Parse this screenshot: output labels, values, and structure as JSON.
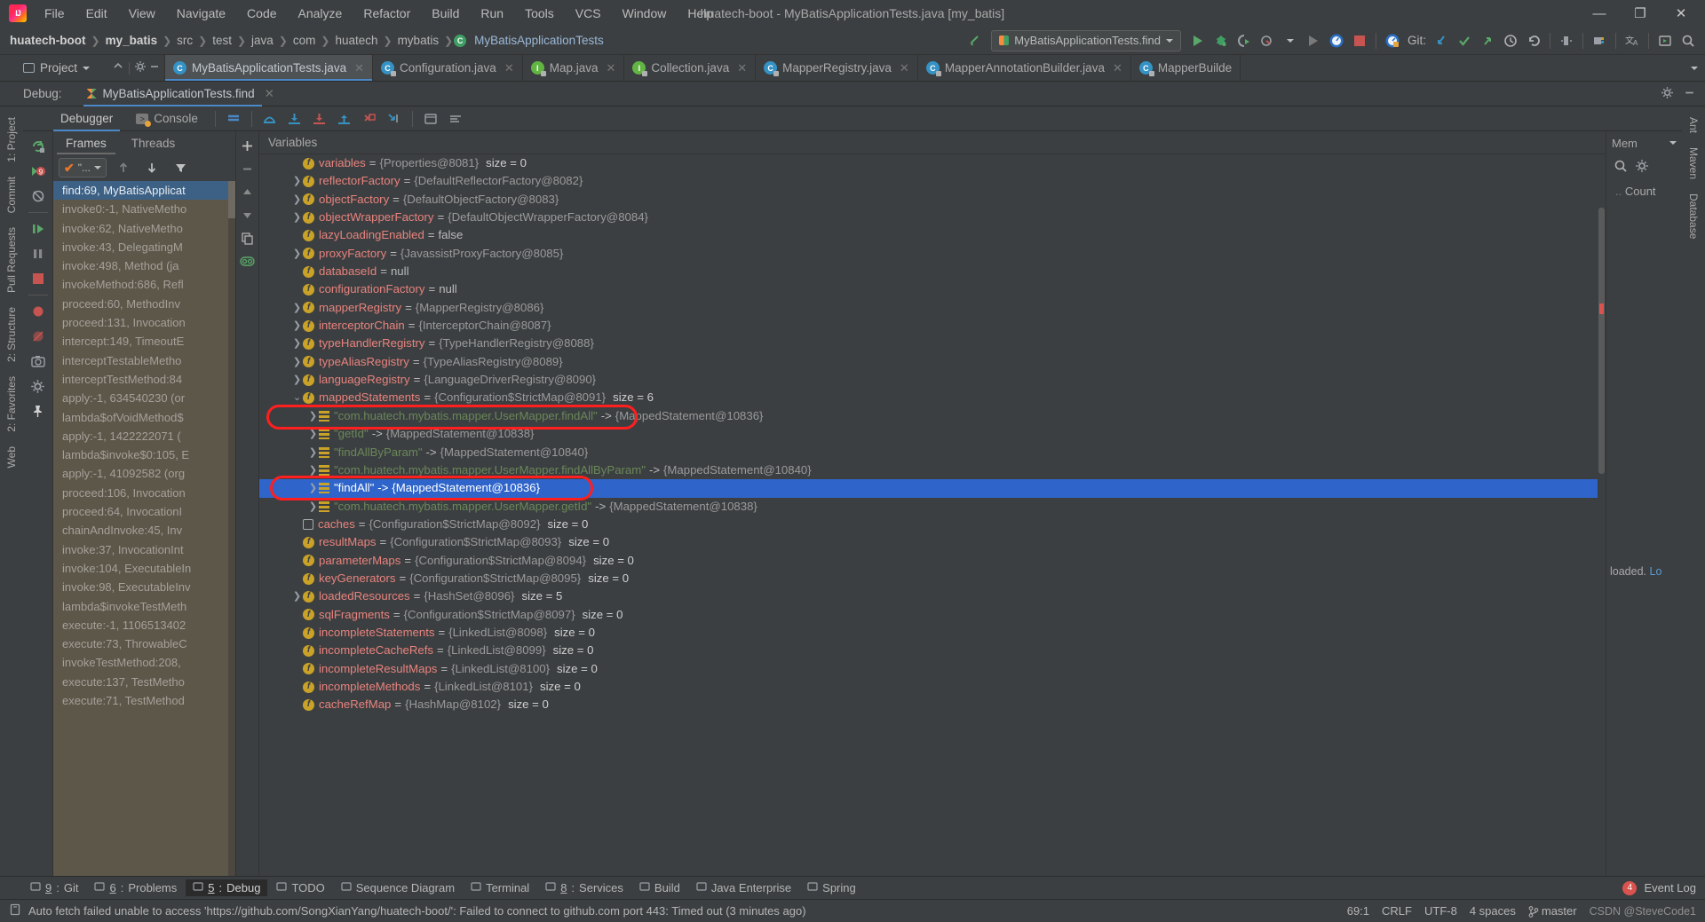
{
  "window": {
    "title": "huatech-boot - MyBatisApplicationTests.java [my_batis]",
    "minimize": "—",
    "maximize": "❐",
    "close": "✕"
  },
  "menu": [
    "File",
    "Edit",
    "View",
    "Navigate",
    "Code",
    "Analyze",
    "Refactor",
    "Build",
    "Run",
    "Tools",
    "VCS",
    "Window",
    "Help"
  ],
  "breadcrumb": [
    {
      "label": "huatech-boot",
      "bold": true
    },
    {
      "label": "my_batis",
      "bold": true
    },
    {
      "label": "src",
      "bold": false
    },
    {
      "label": "test",
      "bold": false
    },
    {
      "label": "java",
      "bold": false
    },
    {
      "label": "com",
      "bold": false
    },
    {
      "label": "huatech",
      "bold": false
    },
    {
      "label": "mybatis",
      "bold": false
    },
    {
      "label": "MyBatisApplicationTests",
      "bold": false,
      "cls": true
    }
  ],
  "run_toolbar": {
    "config_name": "MyBatisApplicationTests.find",
    "git_label": "Git:"
  },
  "editor_tabs": [
    {
      "label": "MyBatisApplicationTests.java",
      "kind": "c",
      "active": true
    },
    {
      "label": "Configuration.java",
      "kind": "c",
      "active": false
    },
    {
      "label": "Map.java",
      "kind": "i",
      "active": false
    },
    {
      "label": "Collection.java",
      "kind": "i",
      "active": false
    },
    {
      "label": "MapperRegistry.java",
      "kind": "c",
      "active": false
    },
    {
      "label": "MapperAnnotationBuilder.java",
      "kind": "c",
      "active": false
    },
    {
      "label": "MapperBuilde",
      "kind": "c",
      "active": false
    }
  ],
  "project_panel": {
    "title": "Project"
  },
  "debug_window": {
    "label": "Debug:",
    "session_tab": "MyBatisApplicationTests.find",
    "subtabs": [
      {
        "label": "Debugger",
        "active": true
      },
      {
        "label": "Console",
        "active": false
      }
    ],
    "frames_tabs": [
      {
        "label": "Frames",
        "active": true
      },
      {
        "label": "Threads",
        "active": false
      }
    ],
    "thread_selector": "\"...",
    "variables_title": "Variables"
  },
  "frames": [
    {
      "text": "find:69, MyBatisApplicat",
      "selected": true
    },
    {
      "text": "invoke0:-1, NativeMetho",
      "selected": false
    },
    {
      "text": "invoke:62, NativeMetho",
      "selected": false
    },
    {
      "text": "invoke:43, DelegatingM",
      "selected": false
    },
    {
      "text": "invoke:498, Method (ja",
      "selected": false,
      "italic_tail": true
    },
    {
      "text": "invokeMethod:686, Refl",
      "selected": false
    },
    {
      "text": "proceed:60, MethodInv",
      "selected": false
    },
    {
      "text": "proceed:131, Invocation",
      "selected": false
    },
    {
      "text": "intercept:149, TimeoutE",
      "selected": false
    },
    {
      "text": "interceptTestableMetho",
      "selected": false
    },
    {
      "text": "interceptTestMethod:84",
      "selected": false
    },
    {
      "text": "apply:-1, 634540230 (or",
      "selected": false,
      "italic_tail": true
    },
    {
      "text": "lambda$ofVoidMethod$",
      "selected": false
    },
    {
      "text": "apply:-1, 1422222071 (",
      "selected": false
    },
    {
      "text": "lambda$invoke$0:105, E",
      "selected": false
    },
    {
      "text": "apply:-1, 41092582 (org",
      "selected": false,
      "italic_tail": true
    },
    {
      "text": "proceed:106, Invocation",
      "selected": false
    },
    {
      "text": "proceed:64, InvocationI",
      "selected": false
    },
    {
      "text": "chainAndInvoke:45, Inv",
      "selected": false
    },
    {
      "text": "invoke:37, InvocationInt",
      "selected": false
    },
    {
      "text": "invoke:104, ExecutableIn",
      "selected": false
    },
    {
      "text": "invoke:98, ExecutableInv",
      "selected": false
    },
    {
      "text": "lambda$invokeTestMeth",
      "selected": false
    },
    {
      "text": "execute:-1, 1106513402",
      "selected": false
    },
    {
      "text": "execute:73, ThrowableC",
      "selected": false
    },
    {
      "text": "invokeTestMethod:208,",
      "selected": false
    },
    {
      "text": "execute:137, TestMetho",
      "selected": false
    },
    {
      "text": "execute:71, TestMethod",
      "selected": false
    }
  ],
  "variables": [
    {
      "indent": 1,
      "chev": "none",
      "icon": "f",
      "name": "variables",
      "value": "{Properties@8081}",
      "size": "size = 0"
    },
    {
      "indent": 1,
      "chev": "right",
      "icon": "f",
      "name": "reflectorFactory",
      "value": "{DefaultReflectorFactory@8082}",
      "size": ""
    },
    {
      "indent": 1,
      "chev": "right",
      "icon": "f",
      "name": "objectFactory",
      "value": "{DefaultObjectFactory@8083}",
      "size": ""
    },
    {
      "indent": 1,
      "chev": "right",
      "icon": "f",
      "name": "objectWrapperFactory",
      "value": "{DefaultObjectWrapperFactory@8084}",
      "size": ""
    },
    {
      "indent": 1,
      "chev": "none",
      "icon": "f",
      "name": "lazyLoadingEnabled",
      "value": "false",
      "literal": true,
      "size": ""
    },
    {
      "indent": 1,
      "chev": "right",
      "icon": "f",
      "name": "proxyFactory",
      "value": "{JavassistProxyFactory@8085}",
      "size": ""
    },
    {
      "indent": 1,
      "chev": "none",
      "icon": "f",
      "name": "databaseId",
      "value": "null",
      "literal": true,
      "size": ""
    },
    {
      "indent": 1,
      "chev": "none",
      "icon": "f",
      "name": "configurationFactory",
      "value": "null",
      "literal": true,
      "size": ""
    },
    {
      "indent": 1,
      "chev": "right",
      "icon": "f",
      "name": "mapperRegistry",
      "value": "{MapperRegistry@8086}",
      "size": ""
    },
    {
      "indent": 1,
      "chev": "right",
      "icon": "f",
      "name": "interceptorChain",
      "value": "{InterceptorChain@8087}",
      "size": ""
    },
    {
      "indent": 1,
      "chev": "right",
      "icon": "f",
      "name": "typeHandlerRegistry",
      "value": "{TypeHandlerRegistry@8088}",
      "size": ""
    },
    {
      "indent": 1,
      "chev": "right",
      "icon": "f",
      "name": "typeAliasRegistry",
      "value": "{TypeAliasRegistry@8089}",
      "size": ""
    },
    {
      "indent": 1,
      "chev": "right",
      "icon": "f",
      "name": "languageRegistry",
      "value": "{LanguageDriverRegistry@8090}",
      "size": ""
    },
    {
      "indent": 1,
      "chev": "down",
      "icon": "f",
      "name": "mappedStatements",
      "value": "{Configuration$StrictMap@8091}",
      "size": "size = 6"
    },
    {
      "indent": 2,
      "chev": "right",
      "icon": "m",
      "str": "\"com.huatech.mybatis.mapper.UserMapper.findAll\"",
      "arrow": " -> ",
      "value": "{MappedStatement@10836}",
      "size": ""
    },
    {
      "indent": 2,
      "chev": "right",
      "icon": "m",
      "str": "\"getId\"",
      "arrow": " -> ",
      "value": "{MappedStatement@10838}",
      "size": ""
    },
    {
      "indent": 2,
      "chev": "right",
      "icon": "m",
      "str": "\"findAllByParam\"",
      "arrow": " -> ",
      "value": "{MappedStatement@10840}",
      "size": ""
    },
    {
      "indent": 2,
      "chev": "right",
      "icon": "m",
      "str": "\"com.huatech.mybatis.mapper.UserMapper.findAllByParam\"",
      "arrow": " -> ",
      "value": "{MappedStatement@10840}",
      "size": ""
    },
    {
      "indent": 2,
      "chev": "right",
      "icon": "m",
      "str": "\"findAll\"",
      "arrow": " -> ",
      "value": "{MappedStatement@10836}",
      "size": "",
      "selected": true
    },
    {
      "indent": 2,
      "chev": "right",
      "icon": "m",
      "str": "\"com.huatech.mybatis.mapper.UserMapper.getId\"",
      "arrow": " -> ",
      "value": "{MappedStatement@10838}",
      "size": ""
    },
    {
      "indent": 1,
      "chev": "none",
      "icon": "k",
      "name": "caches",
      "value": "{Configuration$StrictMap@8092}",
      "size": "size = 0"
    },
    {
      "indent": 1,
      "chev": "none",
      "icon": "f",
      "name": "resultMaps",
      "value": "{Configuration$StrictMap@8093}",
      "size": "size = 0"
    },
    {
      "indent": 1,
      "chev": "none",
      "icon": "f",
      "name": "parameterMaps",
      "value": "{Configuration$StrictMap@8094}",
      "size": "size = 0"
    },
    {
      "indent": 1,
      "chev": "none",
      "icon": "f",
      "name": "keyGenerators",
      "value": "{Configuration$StrictMap@8095}",
      "size": "size = 0"
    },
    {
      "indent": 1,
      "chev": "right",
      "icon": "f",
      "name": "loadedResources",
      "value": "{HashSet@8096}",
      "size": "size = 5"
    },
    {
      "indent": 1,
      "chev": "none",
      "icon": "f",
      "name": "sqlFragments",
      "value": "{Configuration$StrictMap@8097}",
      "size": "size = 0"
    },
    {
      "indent": 1,
      "chev": "none",
      "icon": "f",
      "name": "incompleteStatements",
      "value": "{LinkedList@8098}",
      "size": "size = 0"
    },
    {
      "indent": 1,
      "chev": "none",
      "icon": "f",
      "name": "incompleteCacheRefs",
      "value": "{LinkedList@8099}",
      "size": "size = 0"
    },
    {
      "indent": 1,
      "chev": "none",
      "icon": "f",
      "name": "incompleteResultMaps",
      "value": "{LinkedList@8100}",
      "size": "size = 0"
    },
    {
      "indent": 1,
      "chev": "none",
      "icon": "f",
      "name": "incompleteMethods",
      "value": "{LinkedList@8101}",
      "size": "size = 0"
    },
    {
      "indent": 1,
      "chev": "none",
      "icon": "f",
      "name": "cacheRefMap",
      "value": "{HashMap@8102}",
      "size": "size = 0"
    }
  ],
  "memory_pane": {
    "title": "Mem",
    "column": "Count",
    "note_prefix": "loaded.",
    "note_link": "Lo"
  },
  "left_rail": [
    "1: Project",
    "Commit",
    "Pull Requests",
    "2: Structure",
    "2: Favorites",
    "Web"
  ],
  "right_rail": [
    "Ant",
    "Maven",
    "Database"
  ],
  "bottom_tools": [
    {
      "num": "9",
      "label": "Git",
      "active": false
    },
    {
      "num": "6",
      "label": "Problems",
      "active": false
    },
    {
      "num": "5",
      "label": "Debug",
      "active": true
    },
    {
      "num": "",
      "label": "TODO",
      "active": false
    },
    {
      "num": "",
      "label": "Sequence Diagram",
      "active": false
    },
    {
      "num": "",
      "label": "Terminal",
      "active": false
    },
    {
      "num": "8",
      "label": "Services",
      "active": false
    },
    {
      "num": "",
      "label": "Build",
      "active": false
    },
    {
      "num": "",
      "label": "Java Enterprise",
      "active": false
    },
    {
      "num": "",
      "label": "Spring",
      "active": false
    }
  ],
  "event_log": {
    "count": "4",
    "label": "Event Log"
  },
  "status": {
    "message": "Auto fetch failed unable to access 'https://github.com/SongXianYang/huatech-boot/': Failed to connect to github.com port 443: Timed out (3 minutes ago)",
    "caret": "69:1",
    "line_sep": "CRLF",
    "encoding": "UTF-8",
    "indent": "4 spaces",
    "branch": "master",
    "watermark": "CSDN @SteveCode1"
  },
  "colors": {
    "accent_blue": "#2f65ca",
    "annotation_red": "#ff1f1f",
    "frame_bg": "#5d574a",
    "name_pink": "#e8837e",
    "string_green": "#6a8759"
  }
}
